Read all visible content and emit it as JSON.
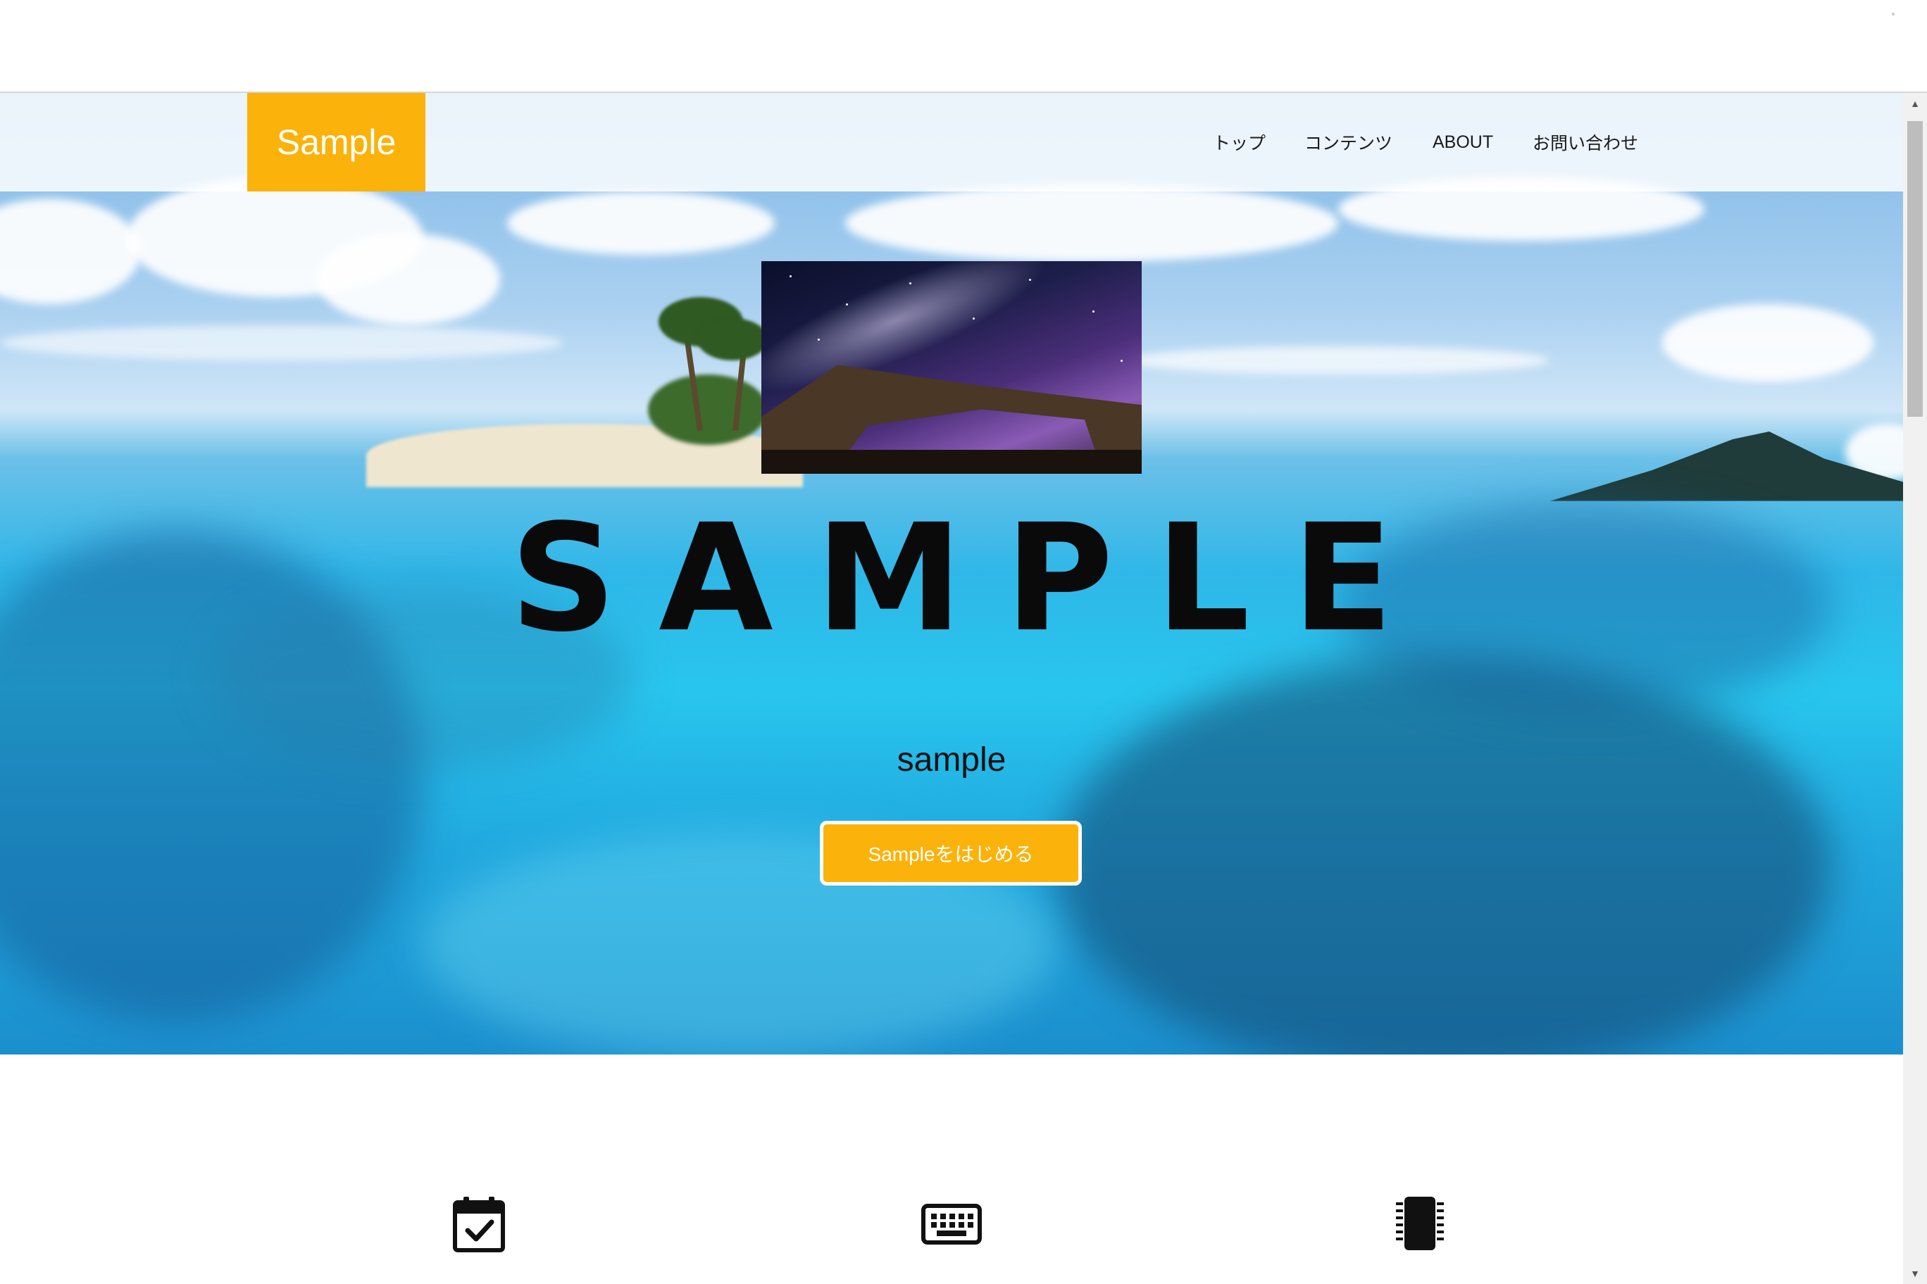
{
  "header": {
    "logo": "Sample",
    "nav": [
      {
        "label": "トップ"
      },
      {
        "label": "コンテンツ"
      },
      {
        "label": "ABOUT"
      },
      {
        "label": "お問い合わせ"
      }
    ]
  },
  "hero": {
    "title": "SAMPLE",
    "subtitle": "sample",
    "cta_label": "Sampleをはじめる"
  },
  "features": {
    "icons": [
      "calendar-check-icon",
      "keyboard-icon",
      "memory-chip-icon"
    ]
  },
  "colors": {
    "accent": "#fbb20a",
    "text": "#0a0a0a"
  }
}
